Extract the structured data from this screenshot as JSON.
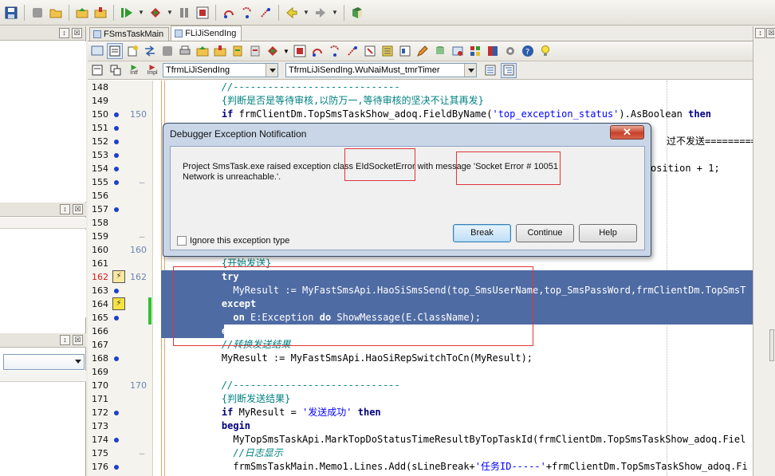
{
  "topbar": {
    "icons": [
      "save-icon",
      "save-all-icon",
      "open-folder-icon",
      "open-project-icon",
      "add-file-icon",
      "run-icon",
      "run-dropdown-icon",
      "build-icon",
      "build-dropdown-icon",
      "pause-icon",
      "stop-icon",
      "step-over-icon",
      "trace-into-icon",
      "run-to-cursor-icon",
      "back-icon",
      "back-dropdown-icon",
      "forward-icon",
      "forward-dropdown-icon",
      "help-book-icon"
    ]
  },
  "tabs": [
    {
      "label": "FSmsTaskMain",
      "active": false
    },
    {
      "label": "FLiJiSendIng",
      "active": true
    }
  ],
  "toolbar3": {
    "intf_label": "Intf",
    "impl_label": "Impl",
    "class_combo": "TfrmLiJiSendIng",
    "method_combo": "TfrmLiJiSendIng.WuNaiMust_tmrTimer"
  },
  "code_lines": [
    {
      "n": "148",
      "html": "    <span class=\"cm\">//-----------------------------</span>"
    },
    {
      "n": "149",
      "html": "    <span class=\"cmzh\">{判断是否是等待审核,以防万一,等待审核的坚决不让其再发}</span>",
      "dot": false
    },
    {
      "n": "150",
      "html": "    <span class=\"kw\">if</span> frmClientDm.TopSmsTaskShow_adoq.FieldByName(<span class=\"str\">'top_exception_status'</span>).AsBoolean <span class=\"kw\">then</span>",
      "dot": true,
      "cov": "150"
    },
    {
      "n": "151",
      "html": "",
      "dot": true
    },
    {
      "n": "152",
      "html": "",
      "dot": true
    },
    {
      "n": "153",
      "html": "",
      "dot": true
    },
    {
      "n": "154",
      "html": "",
      "dot": true
    },
    {
      "n": "155",
      "html": "",
      "dot": true
    },
    {
      "n": "156",
      "html": ""
    },
    {
      "n": "157",
      "html": "",
      "dot": true
    },
    {
      "n": "158",
      "html": ""
    },
    {
      "n": "159",
      "html": ""
    },
    {
      "n": "160",
      "html": "",
      "cov": "160"
    },
    {
      "n": "161",
      "html": "    <span class=\"cmzh\">{开始发送}</span>"
    },
    {
      "n": "162",
      "html": "    <span class=\"kw\">try</span>",
      "err": true,
      "cov": "162"
    },
    {
      "n": "163",
      "html": "      MyResult := MyFastSmsApi.HaoSiSmsSend(top_SmsUserName,top_SmsPassWord,frmClientDm.TopSmsT",
      "dot": true
    },
    {
      "n": "164",
      "html": "    <span class=\"kw\">except</span>",
      "dot": true
    },
    {
      "n": "165",
      "html": "      <span class=\"kw\">on</span> E:Exception <span class=\"kw\">do</span> ShowMessage(E.ClassName);",
      "dot": true
    },
    {
      "n": "166",
      "html": "    <span class=\"kw\">end</span>;"
    },
    {
      "n": "167",
      "html": "    <span class=\"cm\">//转换发送结果</span>"
    },
    {
      "n": "168",
      "html": "    MyResult := MyFastSmsApi.HaoSiRepSwitchToCn(MyResult);",
      "dot": true
    },
    {
      "n": "169",
      "html": ""
    },
    {
      "n": "170",
      "html": "    <span class=\"cm\">//-----------------------------</span>",
      "cov": "170"
    },
    {
      "n": "171",
      "html": "    <span class=\"cmzh\">{判断发送结果}</span>"
    },
    {
      "n": "172",
      "html": "    <span class=\"kw\">if</span> MyResult = <span class=\"str\">'发送成功'</span> <span class=\"kw\">then</span>",
      "dot": true
    },
    {
      "n": "173",
      "html": "    <span class=\"kw\">begin</span>"
    },
    {
      "n": "174",
      "html": "      MyTopSmsTaskApi.MarkTopDoStatusTimeResultByTopTaskId(frmClientDm.TopSmsTaskShow_adoq.Fiel",
      "dot": true
    },
    {
      "n": "175",
      "html": "      <span class=\"cm\">//日志显示</span>"
    },
    {
      "n": "176",
      "html": "      frmSmsTaskMain.Memo1.Lines.Add(sLineBreak+<span class=\"str\">'任务ID-----'</span>+frmClientDm.TopSmsTaskShow_adoq.Fi",
      "dot": true
    }
  ],
  "hidden_line_fragments": {
    "line151_tail": "过不发送=========='",
    "line154_tail": "osition + 1;"
  },
  "dialog": {
    "title": "Debugger Exception Notification",
    "close_label": "✕",
    "message_line1": "Project SmsTask.exe raised exception class EIdSocketError with message 'Socket Error # 10051",
    "message_line2": "Network is unreachable.'.",
    "checkbox_label": "Ignore this exception type",
    "break_label": "Break",
    "continue_label": "Continue",
    "help_label": "Help"
  },
  "panels": {
    "pin_label": "↕",
    "close_label": "☒"
  }
}
